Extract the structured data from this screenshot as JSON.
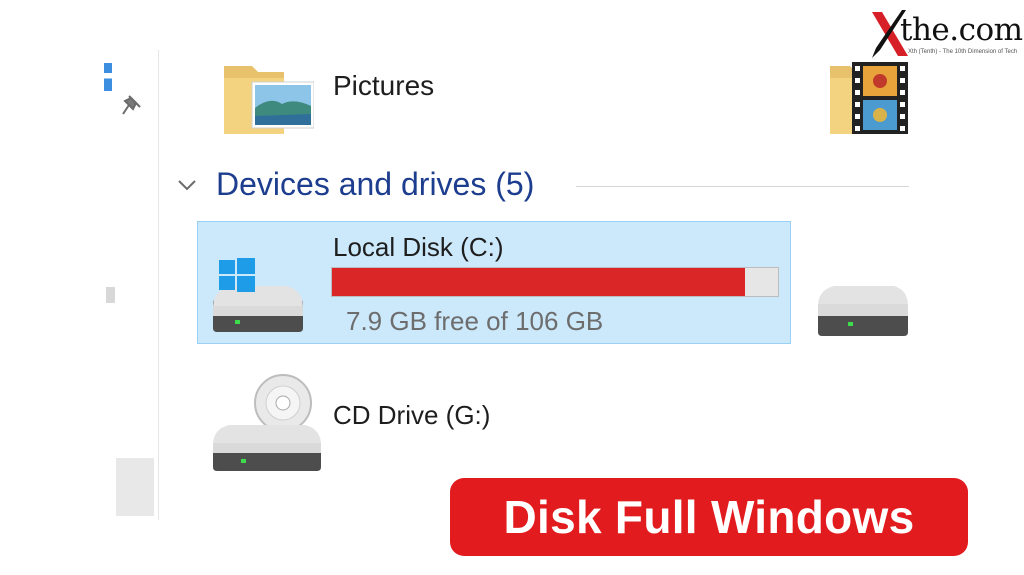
{
  "logo": {
    "text": "the.com",
    "tagline": "Xth (Tenth) - The 10th Dimension of Tech"
  },
  "folders": [
    {
      "label": "Pictures",
      "icon": "pictures-folder-icon"
    },
    {
      "label": "",
      "icon": "videos-folder-icon"
    }
  ],
  "devices_group": {
    "title": "Devices and drives (5)",
    "icon": "chevron-down-icon"
  },
  "drives": [
    {
      "name": "Local Disk (C:)",
      "free_text": "7.9 GB free of 106 GB",
      "free_gb": 7.9,
      "total_gb": 106,
      "used_fraction": 0.925,
      "bar_color": "#da2626",
      "selected": true,
      "icon": "windows-drive-icon"
    },
    {
      "name": "",
      "icon": "hard-drive-icon"
    },
    {
      "name": "CD Drive (G:)",
      "icon": "cd-drive-icon"
    }
  ],
  "caption": {
    "text": "Disk Full Windows",
    "color": "#e21b1e"
  },
  "colors": {
    "selection": "#cce8fb",
    "header_text": "#1d3d8f",
    "accent_blue": "#3c8fe0"
  }
}
